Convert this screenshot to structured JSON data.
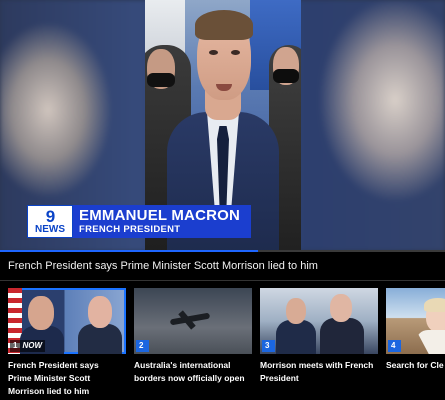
{
  "video": {
    "lower_third": {
      "logo_number": "9",
      "logo_word": "NEWS",
      "name": "EMMANUEL MACRON",
      "title": "FRENCH PRESIDENT"
    },
    "progress_fraction": 0.58
  },
  "headline": "French President says Prime Minister Scott Morrison lied to him",
  "carousel": {
    "now_label": "NOW",
    "cards": [
      {
        "index": "1",
        "title": "French President says Prime Minister Scott Morrison lied to him",
        "active": true
      },
      {
        "index": "2",
        "title": "Australia's international borders now officially open",
        "active": false
      },
      {
        "index": "3",
        "title": "Morrison meets with French President",
        "active": false
      },
      {
        "index": "4",
        "title": "Search for Cle",
        "active": false
      }
    ]
  },
  "colors": {
    "accent": "#1b3ecf",
    "progress": "#1e66ff",
    "active_outline": "#1b73ff",
    "badge": "#1b66e0"
  }
}
